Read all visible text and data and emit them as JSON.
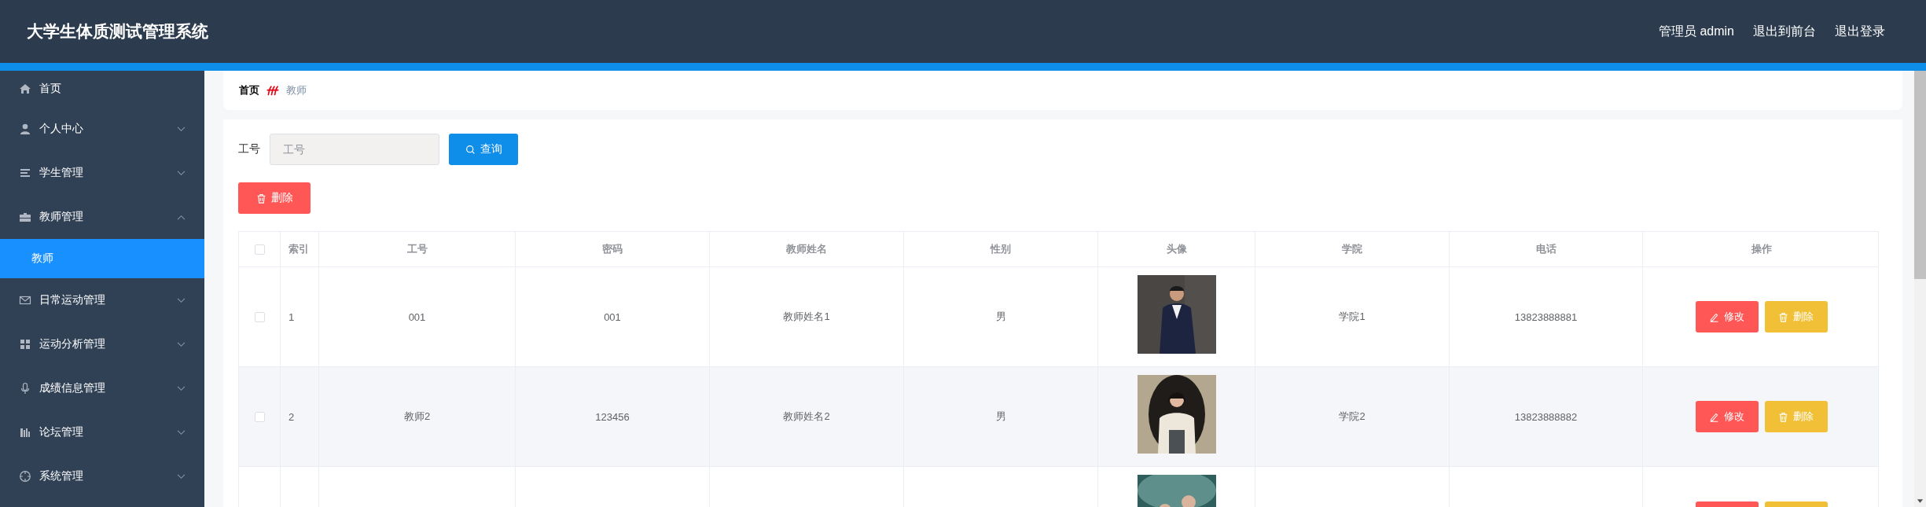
{
  "header": {
    "title": "大学生体质测试管理系统",
    "links": [
      "管理员 admin",
      "退出到前台",
      "退出登录"
    ]
  },
  "sidebar": {
    "items": [
      {
        "label": "首页",
        "selected": false
      },
      {
        "label": "个人中心",
        "selected": false,
        "expanded": false
      },
      {
        "label": "学生管理",
        "selected": false,
        "expanded": false
      },
      {
        "label": "教师管理",
        "selected": false,
        "expanded": true,
        "children": [
          {
            "label": "教师",
            "selected": true
          }
        ]
      },
      {
        "label": "日常运动管理",
        "selected": false,
        "expanded": false
      },
      {
        "label": "运动分析管理",
        "selected": false,
        "expanded": false
      },
      {
        "label": "成绩信息管理",
        "selected": false,
        "expanded": false
      },
      {
        "label": "论坛管理",
        "selected": false,
        "expanded": false
      },
      {
        "label": "系统管理",
        "selected": false,
        "expanded": false
      }
    ]
  },
  "breadcrumb": [
    "首页",
    "教师"
  ],
  "search": {
    "label": "工号",
    "placeholder": "工号",
    "button": "查询"
  },
  "toolbar": {
    "delete_button": "删除"
  },
  "table": {
    "select_all": {
      "checked": false
    },
    "columns": [
      "索引",
      "工号",
      "密码",
      "教师姓名",
      "性别",
      "头像",
      "学院",
      "电话",
      "操作"
    ],
    "rows": [
      {
        "kind": "full",
        "checked": false,
        "cells": [
          "1",
          "001",
          "001",
          "教师姓名1",
          "男",
          "学院1",
          "13823888881"
        ],
        "actions": [
          "修改",
          "删除"
        ]
      },
      {
        "kind": "full",
        "checked": false,
        "cells": [
          "2",
          "教师2",
          "123456",
          "教师姓名2",
          "男",
          "学院2",
          "13823888882"
        ],
        "actions": [
          "修改",
          "删除"
        ]
      },
      {
        "kind": "partial"
      }
    ]
  }
}
